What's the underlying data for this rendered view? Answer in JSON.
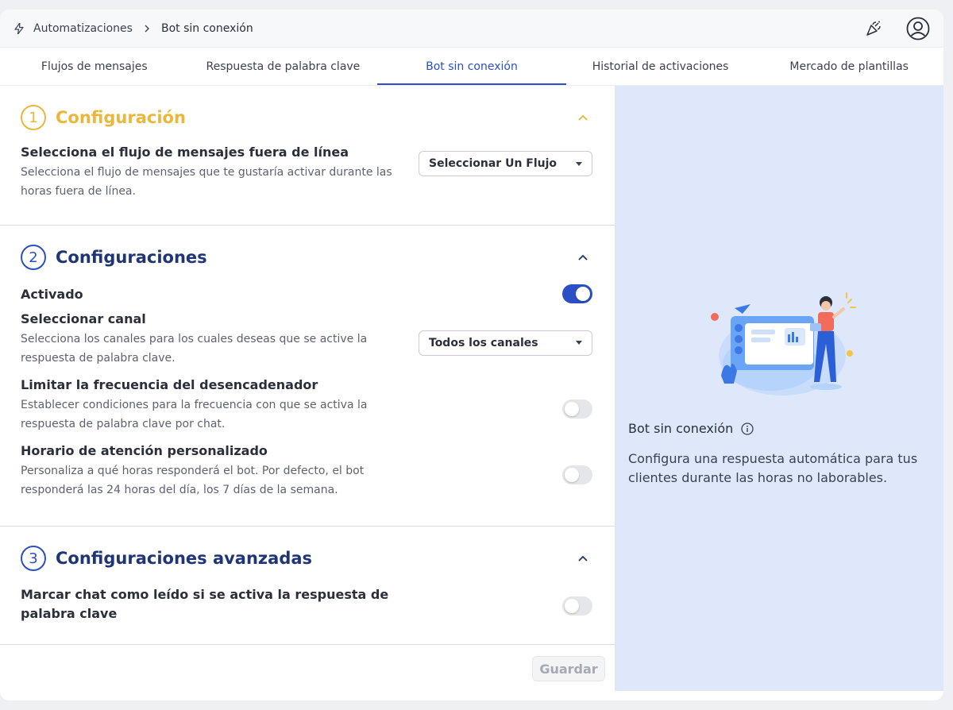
{
  "breadcrumb": {
    "root": "Automatizaciones",
    "current": "Bot sin conexión"
  },
  "tabs": [
    {
      "label": "Flujos de mensajes"
    },
    {
      "label": "Respuesta de palabra clave"
    },
    {
      "label": "Bot sin conexión"
    },
    {
      "label": "Historial de activaciones"
    },
    {
      "label": "Mercado de plantillas"
    }
  ],
  "sections": {
    "s1": {
      "number": "1",
      "title": "Configuración",
      "row": {
        "title": "Selecciona el flujo de mensajes fuera de línea",
        "desc": "Selecciona el flujo de mensajes que te gustaría activar durante las horas fuera de línea.",
        "select": "Seleccionar Un Flujo"
      }
    },
    "s2": {
      "number": "2",
      "title": "Configuraciones",
      "activated": {
        "label": "Activado",
        "on": true
      },
      "channel": {
        "title": "Seleccionar canal",
        "desc": "Selecciona los canales para los cuales deseas que se active la respuesta de palabra clave.",
        "select": "Todos los canales"
      },
      "frequency": {
        "title": "Limitar la frecuencia del desencadenador",
        "desc": "Establecer condiciones para la frecuencia con que se activa la respuesta de palabra clave por chat.",
        "on": false
      },
      "hours": {
        "title": "Horario de atención personalizado",
        "desc": "Personaliza a qué horas responderá el bot. Por defecto, el bot responderá las 24 horas del día, los 7 días de la semana.",
        "on": false
      }
    },
    "s3": {
      "number": "3",
      "title": "Configuraciones avanzadas",
      "mark_read": {
        "title": "Marcar chat como leído si se activa la respuesta de palabra clave",
        "on": false
      }
    }
  },
  "footer": {
    "save_label": "Guardar"
  },
  "info": {
    "title": "Bot sin conexión",
    "desc": "Configura una respuesta automática para tus clientes durante las horas no laborables."
  },
  "colors": {
    "accent": "#2b4fc4",
    "section1": "#eab73a",
    "panel": "#dfe8fb"
  }
}
